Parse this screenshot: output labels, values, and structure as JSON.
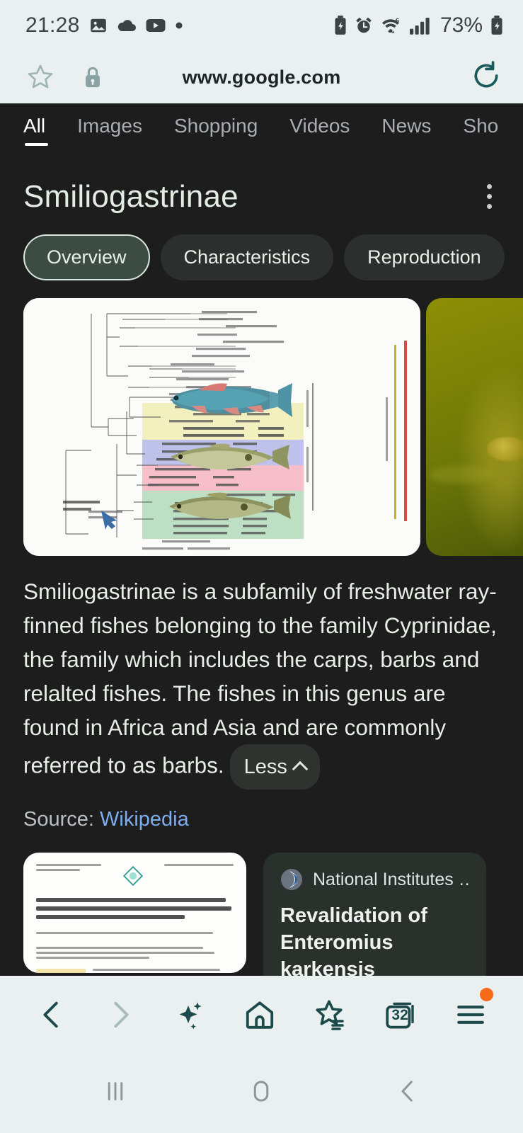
{
  "status_bar": {
    "time": "21:28",
    "left_icons": [
      "image-icon",
      "cloud-icon",
      "youtube-icon",
      "dot-icon"
    ],
    "right_icons": [
      "battery-saver-icon",
      "alarm-icon",
      "wifi-6-icon",
      "signal-bars-icon",
      "battery-icon"
    ],
    "battery_percent": "73%"
  },
  "browser_bar": {
    "bookmark_icon": "star-outline-icon",
    "lock_icon": "lock-icon",
    "url": "www.google.com",
    "reload_icon": "reload-icon"
  },
  "search_tabs": [
    {
      "label": "All",
      "active": true
    },
    {
      "label": "Images",
      "active": false
    },
    {
      "label": "Shopping",
      "active": false
    },
    {
      "label": "Videos",
      "active": false
    },
    {
      "label": "News",
      "active": false
    },
    {
      "label": "Sho",
      "active": false
    }
  ],
  "knowledge_panel": {
    "title": "Smiliogastrinae",
    "menu_icon": "kebab-menu-icon",
    "pills": [
      {
        "label": "Overview",
        "selected": true
      },
      {
        "label": "Characteristics",
        "selected": false
      },
      {
        "label": "Reproduction",
        "selected": false
      }
    ],
    "media": [
      {
        "name": "phylogenetic-tree-image",
        "caption": "Cyprinidae phylogenetic tree with barb fish photos"
      },
      {
        "name": "underwater-fish-photo",
        "caption": "Olive green underwater habitat photo"
      }
    ],
    "description": "Smiliogastrinae is a subfamily of freshwater ray-finned fishes belonging to the family Cyprinidae, the family which includes the carps, barbs and relalted fishes. The fishes in this genus are found in Africa and Asia and are commonly referred to as barbs.",
    "less_label": "Less",
    "source_label": "Source:",
    "source_link": "Wikipedia"
  },
  "result_cards": [
    {
      "type": "document-thumbnail",
      "name": "paper-thumbnail-card",
      "title": "DNA BARCODING OF SMILIOGASTRINAE (TELEOSTEI: CYPRINIFORMES) OF BANGLADESH BASED ON CYTOCHROME C OXIDASE SUBUNIT I (COI) SEQUENCES"
    },
    {
      "type": "link-card",
      "name": "nih-result-card",
      "site_icon": "nih-logo-icon",
      "site": "National Institutes …",
      "title": "Revalidation of Enteromius karkensis (Gilchrist"
    }
  ],
  "browser_toolbar": [
    {
      "name": "back-button",
      "icon": "chevron-left-icon",
      "enabled": true
    },
    {
      "name": "forward-button",
      "icon": "chevron-right-icon",
      "enabled": false
    },
    {
      "name": "ai-assistant-button",
      "icon": "sparkles-icon",
      "enabled": true
    },
    {
      "name": "home-button",
      "icon": "home-icon",
      "enabled": true
    },
    {
      "name": "bookmarks-button",
      "icon": "star-list-icon",
      "enabled": true
    },
    {
      "name": "tabs-button",
      "icon": "tabs-icon",
      "count": "32",
      "enabled": true
    },
    {
      "name": "menu-button",
      "icon": "hamburger-icon",
      "badge": true,
      "enabled": true
    }
  ],
  "android_nav": [
    {
      "name": "recents-button",
      "icon": "recents-icon"
    },
    {
      "name": "home-button",
      "icon": "circle-icon"
    },
    {
      "name": "back-button",
      "icon": "chevron-left-icon"
    }
  ],
  "colors": {
    "page_bg": "#1d1d1d",
    "chrome_bg": "#eaf0f0",
    "accent_green": "#3c4c43",
    "link_blue": "#7cadf0",
    "badge_orange": "#f96a1b",
    "icon_teal": "#1c4a4a"
  }
}
